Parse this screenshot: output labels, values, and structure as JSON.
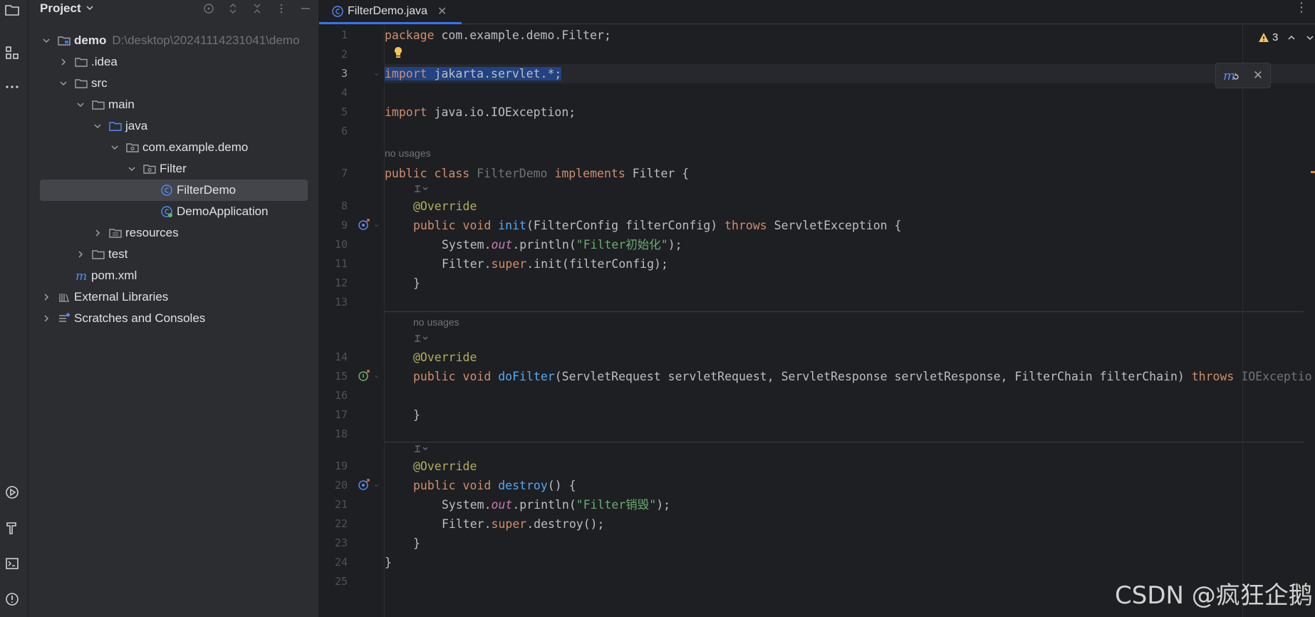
{
  "project_panel": {
    "title": "Project",
    "tree": [
      {
        "label": "demo",
        "hint": "D:\\desktop\\20241114231041\\demo"
      },
      {
        "label": ".idea"
      },
      {
        "label": "src"
      },
      {
        "label": "main"
      },
      {
        "label": "java"
      },
      {
        "label": "com.example.demo"
      },
      {
        "label": "Filter"
      },
      {
        "label": "FilterDemo"
      },
      {
        "label": "DemoApplication"
      },
      {
        "label": "resources"
      },
      {
        "label": "test"
      },
      {
        "label": "pom.xml"
      },
      {
        "label": "External Libraries"
      },
      {
        "label": "Scratches and Consoles"
      }
    ]
  },
  "editor": {
    "tab": {
      "label": "FilterDemo.java"
    },
    "inspection_count": "3",
    "line_numbers": [
      "1",
      "2",
      "3",
      "4",
      "5",
      "6",
      "7",
      "8",
      "9",
      "10",
      "11",
      "12",
      "13",
      "14",
      "15",
      "16",
      "17",
      "18",
      "19",
      "20",
      "21",
      "22",
      "23",
      "24",
      "25"
    ],
    "inlays": {
      "no_usages_1": "no usages",
      "no_usages_2": "no usages"
    },
    "code": {
      "l1a": "package",
      "l1b": " com.example.demo.Filter;",
      "l3a": "import",
      "l3b": " jakarta.servlet.*;",
      "l5a": "import",
      "l5b": " java.io.IOException;",
      "l7a": "public class",
      "l7b": " FilterDemo ",
      "l7c": "implements",
      "l7d": " Filter {",
      "l8": "@Override",
      "l9a": "public void",
      "l9b": "init",
      "l9c": "(FilterConfig filterConfig) ",
      "l9d": "throws",
      "l9e": " ServletException {",
      "l10a": "System.",
      "l10b": "out",
      "l10c": ".println(",
      "l10d": "\"Filter初始化\"",
      "l10e": ");",
      "l11a": "Filter.",
      "l11b": "super",
      "l11c": ".init(filterConfig);",
      "l12": "}",
      "l14": "@Override",
      "l15a": "public void",
      "l15b": "doFilter",
      "l15c": "(ServletRequest servletRequest, ServletResponse servletResponse, FilterChain filterChain) ",
      "l15d": "throws",
      "l15e": " IOExceptio",
      "l17": "}",
      "l19": "@Override",
      "l20a": "public void",
      "l20b": "destroy",
      "l20c": "() {",
      "l21a": "System.",
      "l21b": "out",
      "l21c": ".println(",
      "l21d": "\"Filter销毁\"",
      "l21e": ");",
      "l22a": "Filter.",
      "l22b": "super",
      "l22c": ".destroy();",
      "l23": "}",
      "l24": "}"
    }
  },
  "watermark": "CSDN @疯狂企鹅",
  "colors": {
    "accent": "#3574f0",
    "keyword": "#cf8e6d",
    "annotation": "#b3ae60",
    "function": "#56a8f5",
    "string": "#6aab73",
    "field": "#c77dbb",
    "selection": "#214283"
  }
}
